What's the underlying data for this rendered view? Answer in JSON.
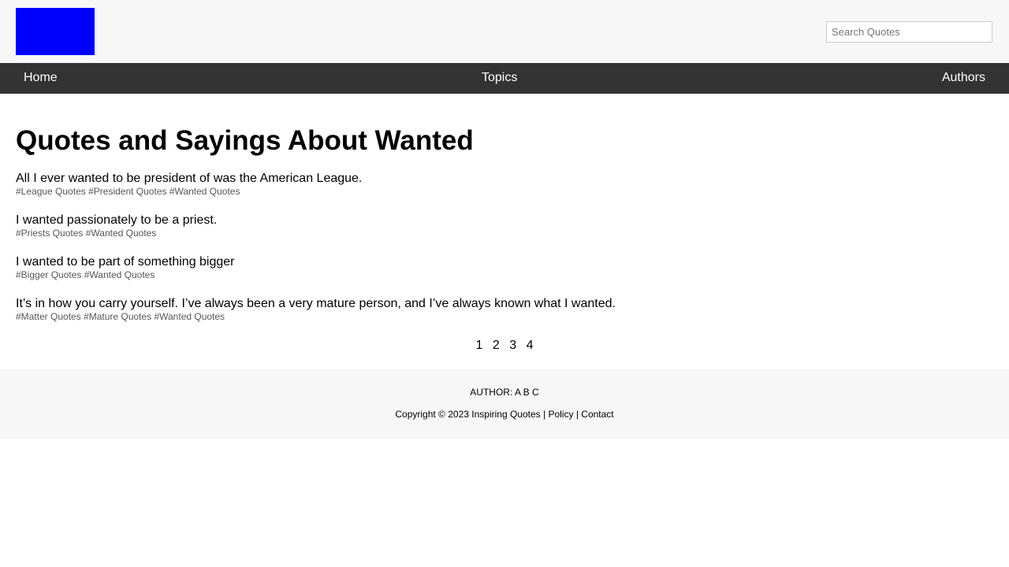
{
  "header": {
    "logo_color": "#0000ff",
    "search_placeholder": "Search Quotes"
  },
  "nav": {
    "home": "Home",
    "topics": "Topics",
    "authors": "Authors"
  },
  "main": {
    "title": "Quotes and Sayings About Wanted",
    "quotes": [
      {
        "text": "All I ever wanted to be president of was the American League.",
        "tags": [
          "#League Quotes",
          "#President Quotes",
          "#Wanted Quotes"
        ]
      },
      {
        "text": "I wanted passionately to be a priest.",
        "tags": [
          "#Priests Quotes",
          "#Wanted Quotes"
        ]
      },
      {
        "text": "I wanted to be part of something bigger",
        "tags": [
          "#Bigger Quotes",
          "#Wanted Quotes"
        ]
      },
      {
        "text": "It’s in how you carry yourself. I’ve always been a very mature person, and I’ve always known what I wanted.",
        "tags": [
          "#Matter Quotes",
          "#Mature Quotes",
          "#Wanted Quotes"
        ]
      }
    ],
    "pages": [
      "1",
      "2",
      "3",
      "4"
    ]
  },
  "footer": {
    "author_label": "AUTHOR:",
    "author_letters": [
      "A",
      "B",
      "C"
    ],
    "copyright": "Copyright © 2023 Inspiring Quotes",
    "policy": "Policy",
    "contact": "Contact",
    "separator": "|"
  }
}
